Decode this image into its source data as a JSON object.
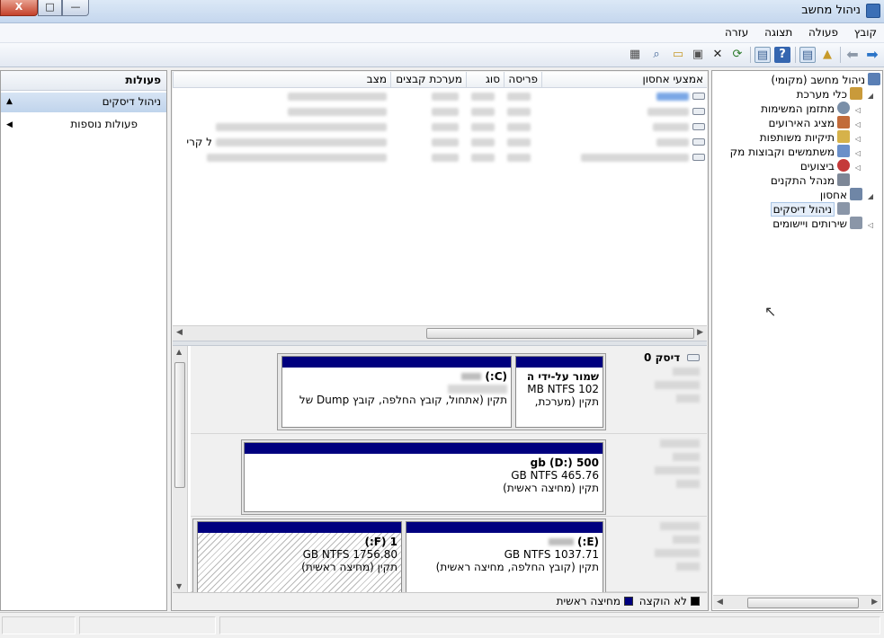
{
  "window": {
    "title": "ניהול מחשב",
    "close_label": "X",
    "max_label": "□",
    "min_label": "—"
  },
  "menu": [
    "קובץ",
    "פעולה",
    "תצוגה",
    "עזרה"
  ],
  "tree": {
    "items": [
      {
        "label": "ניהול מחשב (מקומי)",
        "icon": "computer-icon",
        "color": "#5a7fb5"
      },
      {
        "label": "כלי מערכת",
        "icon": "tools-icon",
        "color": "#c99a3a"
      },
      {
        "label": "מתזמן המשימות",
        "icon": "clock-icon",
        "color": "#7a8fa8"
      },
      {
        "label": "מציג האירועים",
        "icon": "event-viewer-icon",
        "color": "#c26b3a"
      },
      {
        "label": "תיקיות משותפות",
        "icon": "shared-folder-icon",
        "color": "#d6b24a"
      },
      {
        "label": "משתמשים וקבוצות מק",
        "icon": "users-icon",
        "color": "#6a8fc9"
      },
      {
        "label": "ביצועים",
        "icon": "performance-icon",
        "color": "#c43a3a"
      },
      {
        "label": "מנהל התקנים",
        "icon": "device-manager-icon",
        "color": "#7d8797"
      },
      {
        "label": "אחסון",
        "icon": "storage-icon",
        "color": "#6f86a6"
      },
      {
        "label": "ניהול דיסקים",
        "icon": "disk-management-icon",
        "color": "#8a96a8"
      },
      {
        "label": "שירותים ויישומים",
        "icon": "services-icon",
        "color": "#8a96a8"
      }
    ]
  },
  "volumes": {
    "columns": [
      "אמצעי אחסון",
      "פריסה",
      "סוג",
      "מערכת קבצים",
      "מצב"
    ],
    "row4_fragment": "ל קרי"
  },
  "disks": {
    "disk0": {
      "title": "דיסק 0",
      "p1": {
        "name": "שמור על-ידי ה",
        "size": "102 MB NTFS",
        "status": "תקין (מערכת,"
      },
      "p2": {
        "name": "(C:)",
        "status": "תקין (אתחול, קובץ החלפה, קובץ Dump של"
      }
    },
    "disk1": {
      "p1": {
        "name": "500 gb  (D:)",
        "size": "465.76 GB NTFS",
        "status": "תקין (מחיצה ראשית)"
      }
    },
    "disk2": {
      "p1": {
        "name": "(E:)",
        "size": "1037.71 GB NTFS",
        "status": "תקין (קובץ החלפה, מחיצה ראשית)"
      },
      "p2": {
        "name": "1  (F:)",
        "size": "1756.80 GB NTFS",
        "status": "תקין (מחיצה ראשית)"
      }
    }
  },
  "legend": {
    "unallocated": "לא הוקצה",
    "primary": "מחיצה ראשית",
    "unallocated_color": "#000000",
    "primary_color": "#00007f"
  },
  "actions": {
    "title": "פעולות",
    "selected": "ניהול דיסקים",
    "more": "פעולות נוספות"
  }
}
